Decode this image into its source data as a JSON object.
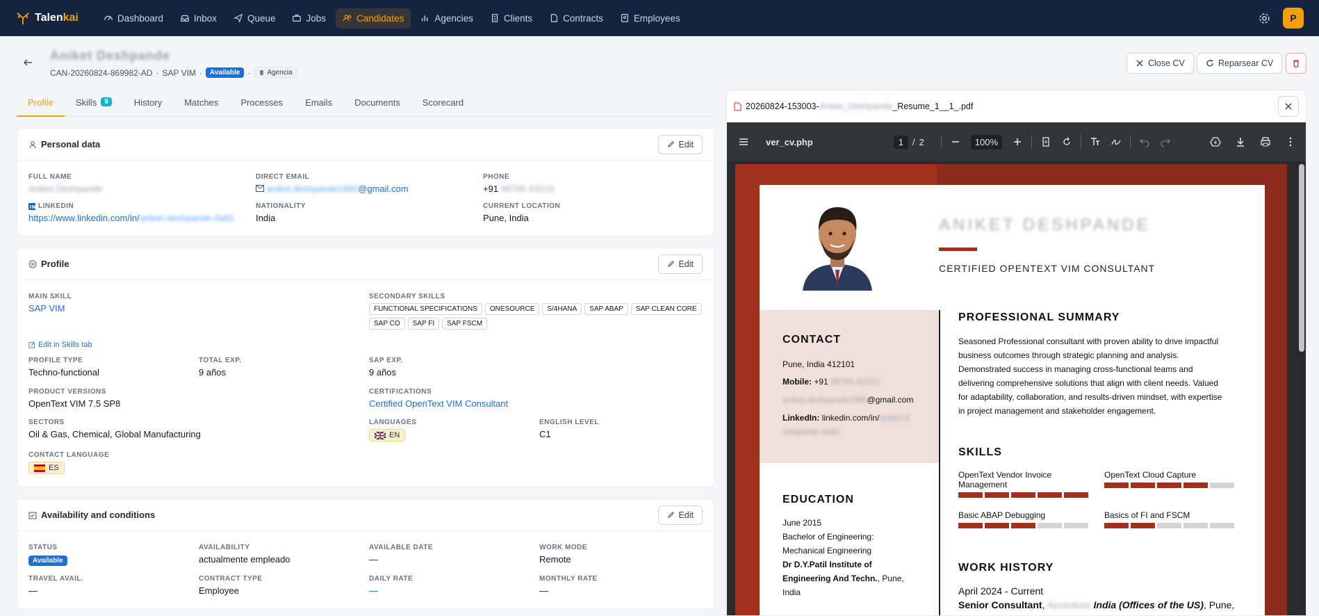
{
  "nav": {
    "brand_prefix": "Talen",
    "brand_suffix": "kai",
    "items": [
      {
        "label": "Dashboard",
        "icon": "dashboard-icon"
      },
      {
        "label": "Inbox",
        "icon": "inbox-icon"
      },
      {
        "label": "Queue",
        "icon": "send-icon"
      },
      {
        "label": "Jobs",
        "icon": "briefcase-icon"
      },
      {
        "label": "Candidates",
        "icon": "users-icon"
      },
      {
        "label": "Agencies",
        "icon": "chart-icon"
      },
      {
        "label": "Clients",
        "icon": "building-icon"
      },
      {
        "label": "Contracts",
        "icon": "file-icon"
      },
      {
        "label": "Employees",
        "icon": "id-card-icon"
      }
    ],
    "active": "Candidates",
    "avatar_initial": "P"
  },
  "header": {
    "name": "Aniket Deshpande",
    "candidate_id": "CAN-20260824-869982-AD",
    "main_skill": "SAP VIM",
    "separator": "·",
    "status": "Available",
    "source": "Agencia",
    "close_cv": "Close CV",
    "reparse_cv": "Reparsear CV"
  },
  "tabs": [
    {
      "label": "Profile"
    },
    {
      "label": "Skills",
      "count": "9"
    },
    {
      "label": "History"
    },
    {
      "label": "Matches"
    },
    {
      "label": "Processes"
    },
    {
      "label": "Emails"
    },
    {
      "label": "Documents"
    },
    {
      "label": "Scorecard"
    }
  ],
  "personal": {
    "title": "Personal data",
    "edit": "Edit",
    "full_name_label": "FULL NAME",
    "full_name": "Aniket Deshpande",
    "email_label": "DIRECT EMAIL",
    "email_hidden": "aniket.deshpande1990",
    "email_domain": "@gmail.com",
    "phone_label": "PHONE",
    "phone_prefix": "+91",
    "phone_hidden": " 98765 43210",
    "linkedin_label": "LINKEDIN",
    "linkedin_visible": "https://www.linkedin.com/in/",
    "linkedin_hidden": "aniket-deshpande-3a91",
    "nationality_label": "NATIONALITY",
    "nationality": "India",
    "location_label": "CURRENT LOCATION",
    "location": "Pune, India"
  },
  "profile": {
    "title": "Profile",
    "edit": "Edit",
    "main_skill_label": "MAIN SKILL",
    "main_skill": "SAP VIM",
    "secondary_label": "SECONDARY SKILLS",
    "secondary": [
      "FUNCTIONAL SPECIFICATIONS",
      "ONESOURCE",
      "S/4HANA",
      "SAP ABAP",
      "SAP CLEAN CORE",
      "SAP CO",
      "SAP FI",
      "SAP FSCM"
    ],
    "edit_skills_link": "Edit in Skills tab",
    "profile_type_label": "PROFILE TYPE",
    "profile_type": "Techno-functional",
    "total_exp_label": "TOTAL EXP.",
    "total_exp": "9 años",
    "sap_exp_label": "SAP EXP.",
    "sap_exp": "9 años",
    "product_versions_label": "PRODUCT VERSIONS",
    "product_versions": "OpenText VIM 7.5 SP8",
    "certifications_label": "CERTIFICATIONS",
    "certifications": "Certified OpenText VIM Consultant",
    "sectors_label": "SECTORS",
    "sectors": "Oil & Gas, Chemical, Global Manufacturing",
    "languages_label": "LANGUAGES",
    "language_code": "EN",
    "english_level_label": "ENGLISH LEVEL",
    "english_level": "C1",
    "contact_language_label": "CONTACT LANGUAGE",
    "contact_language": "ES"
  },
  "availability": {
    "title": "Availability and conditions",
    "edit": "Edit",
    "status_label": "STATUS",
    "status": "Available",
    "availability_label": "AVAILABILITY",
    "availability": "actualmente empleado",
    "available_date_label": "AVAILABLE DATE",
    "available_date": "—",
    "work_mode_label": "WORK MODE",
    "work_mode": "Remote",
    "travel_label": "TRAVEL AVAIL.",
    "travel": "—",
    "contract_type_label": "CONTRACT TYPE",
    "contract_type": "Employee",
    "daily_rate_label": "DAILY RATE",
    "daily_rate": "—",
    "monthly_rate_label": "MONTHLY RATE",
    "monthly_rate": "—"
  },
  "pdf": {
    "file_prefix": "20260824-153003-",
    "file_hidden": "Aniket_Deshpande",
    "file_suffix": "_Resume_1__1_.pdf",
    "viewer_title": "ver_cv.php",
    "page_current": "1",
    "page_sep": "/",
    "page_total": "2",
    "zoom": "100%",
    "cv": {
      "name": "ANIKET DESHPANDE",
      "role": "CERTIFIED OPENTEXT VIM CONSULTANT",
      "contact_h": "CONTACT",
      "address": "Pune, India 412101",
      "mobile_label": "Mobile:",
      "mobile_prefix": " +91",
      "mobile_hidden": " 98765 43210",
      "email_hidden": "aniket.deshpande1990",
      "email_domain": "@gmail.com",
      "linkedin_label": "LinkedIn:",
      "linkedin_visible": " linkedin.com/in/",
      "linkedin_hidden": "aniket-d",
      "linkedin_hidden2": "eshpande-3a91",
      "education_h": "EDUCATION",
      "edu_date": "June 2015",
      "edu_degree1": "Bachelor of Engineering:",
      "edu_degree2": "Mechanical Engineering",
      "edu_school1": "Dr D.Y.Patil Institute of",
      "edu_school2": "Engineering And Techn.",
      "edu_loc1": ", Pune,",
      "edu_loc2": "India",
      "summary_h": "PROFESSIONAL SUMMARY",
      "summary_lines": [
        "Seasoned Professional consultant with proven ability to drive impactful",
        "business outcomes through strategic planning and analysis.",
        "Demonstrated success in managing cross-functional teams and",
        "delivering comprehensive solutions that align with client needs. Valued",
        "for adaptability, collaboration, and results-driven mindset, with expertise",
        "in project management and stakeholder engagement."
      ],
      "skills_h": "SKILLS",
      "skills": [
        {
          "name1": "OpenText Vendor Invoice",
          "name2": "Management",
          "level": 5
        },
        {
          "name1": "OpenText Cloud Capture",
          "name2": "",
          "level": 4
        },
        {
          "name1": "Basic ABAP Debugging",
          "name2": "",
          "level": 3
        },
        {
          "name1": "Basics of FI and FSCM",
          "name2": "",
          "level": 2
        }
      ],
      "work_h": "WORK HISTORY",
      "work_date": "April 2024 - Current",
      "work_title": "Senior Consultant",
      "work_company_hidden": " Accenture",
      "work_company_suffix": " India (Offices of the US)",
      "work_loc": ", Pune,"
    }
  },
  "colors": {
    "nav_bg": "#142340",
    "accent": "#f59e0b",
    "link": "#1d6fe0",
    "cv_accent": "#a0311d"
  }
}
